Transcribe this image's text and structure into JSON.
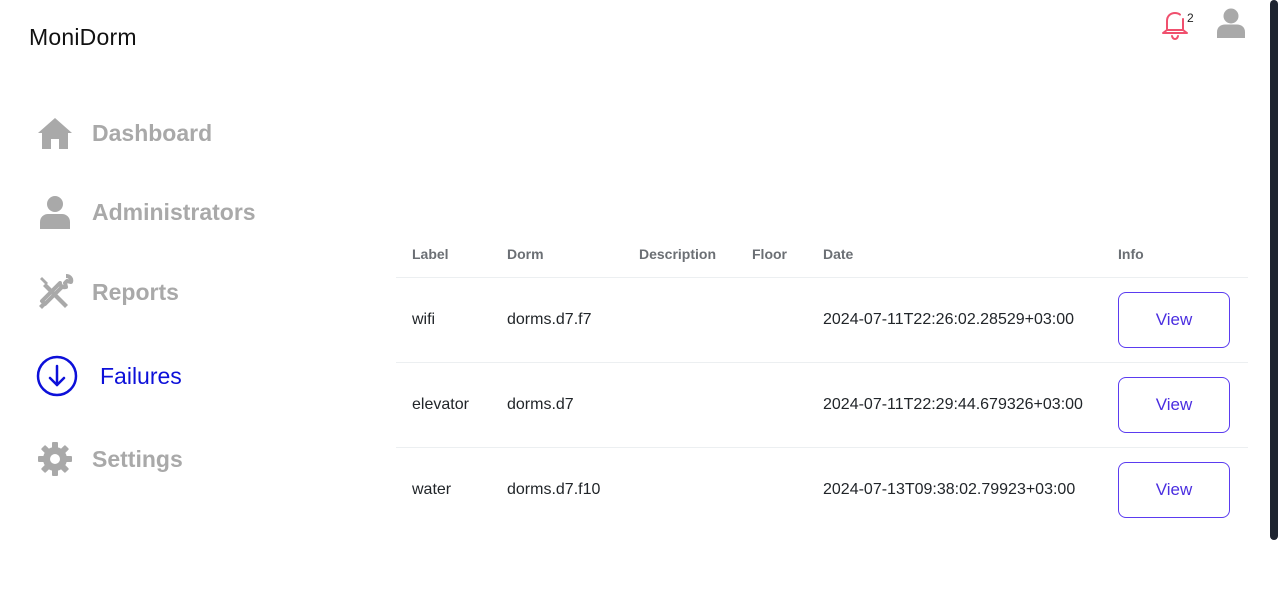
{
  "app": {
    "brand": "MoniDorm"
  },
  "header": {
    "notifications_count": "2",
    "bell_color": "#f0506e",
    "user_icon_color": "#a9a9a9"
  },
  "sidebar": {
    "items": [
      {
        "label": "Dashboard",
        "icon": "home-icon",
        "active": false
      },
      {
        "label": "Administrators",
        "icon": "user-icon",
        "active": false
      },
      {
        "label": "Reports",
        "icon": "tools-icon",
        "active": false
      },
      {
        "label": "Failures",
        "icon": "arrow-down-circle-icon",
        "active": true
      },
      {
        "label": "Settings",
        "icon": "gear-icon",
        "active": false
      }
    ],
    "active_color": "#0d10d9",
    "inactive_color": "#a9a9a9"
  },
  "table": {
    "headers": [
      "Label",
      "Dorm",
      "Description",
      "Floor",
      "Date",
      "Info"
    ],
    "rows": [
      {
        "label": "wifi",
        "dorm": "dorms.d7.f7",
        "description": "",
        "floor": "",
        "date": "2024-07-11T22:26:02.28529+03:00",
        "action": "View"
      },
      {
        "label": "elevator",
        "dorm": "dorms.d7",
        "description": "",
        "floor": "",
        "date": "2024-07-11T22:29:44.679326+03:00",
        "action": "View"
      },
      {
        "label": "water",
        "dorm": "dorms.d7.f10",
        "description": "",
        "floor": "",
        "date": "2024-07-13T09:38:02.79923+03:00",
        "action": "View"
      }
    ]
  }
}
